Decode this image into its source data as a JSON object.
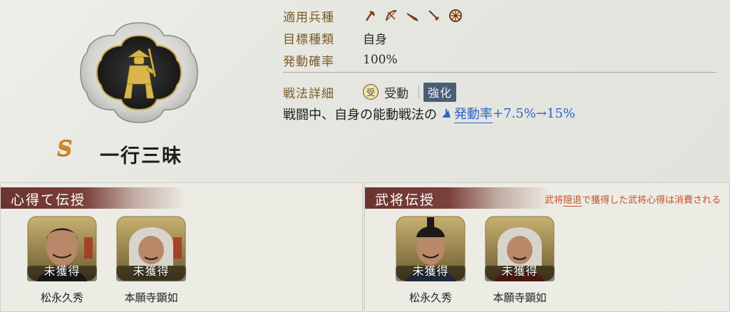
{
  "skill": {
    "grade": "S",
    "name": "一行三昧",
    "emblem_icon": "monk-warrior-emblem-icon"
  },
  "info": {
    "troop_label": "適用兵種",
    "troop_icons": [
      "axe-icon",
      "bow-icon",
      "gun-icon",
      "spear-icon",
      "cavalry-wheel-icon"
    ],
    "target_label": "目標種類",
    "target_value": "自身",
    "rate_label": "発動確率",
    "rate_value": "100%"
  },
  "detail": {
    "label": "戦法詳細",
    "type_icon_char": "受",
    "type_text": "受動",
    "enhance_label": "強化",
    "effect_prefix": "戦闘中、自身の能動戦法の",
    "effect_link": "発動率",
    "effect_suffix": "+7.5%→15%"
  },
  "panels": {
    "left": {
      "title": "心得て伝授",
      "cards": [
        {
          "status": "未獲得",
          "name": "松永久秀",
          "icon": "portrait-matsunaga-icon"
        },
        {
          "status": "未獲得",
          "name": "本願寺顕如",
          "icon": "portrait-kennyo-icon"
        }
      ]
    },
    "right": {
      "title": "武将伝授",
      "note_pre": "武将",
      "note_underlined": "隠退",
      "note_post": "で獲得した武将心得は消費される",
      "cards": [
        {
          "status": "未獲得",
          "name": "松永久秀",
          "icon": "portrait-matsunaga-icon"
        },
        {
          "status": "未獲得",
          "name": "本願寺顕如",
          "icon": "portrait-kennyo-icon"
        }
      ]
    }
  },
  "colors": {
    "label_brown": "#7a5b2a",
    "link_blue": "#2a64c8",
    "grade_orange": "#d88a1e",
    "header_maroon": "#6b3430",
    "note_red": "#c85028"
  }
}
